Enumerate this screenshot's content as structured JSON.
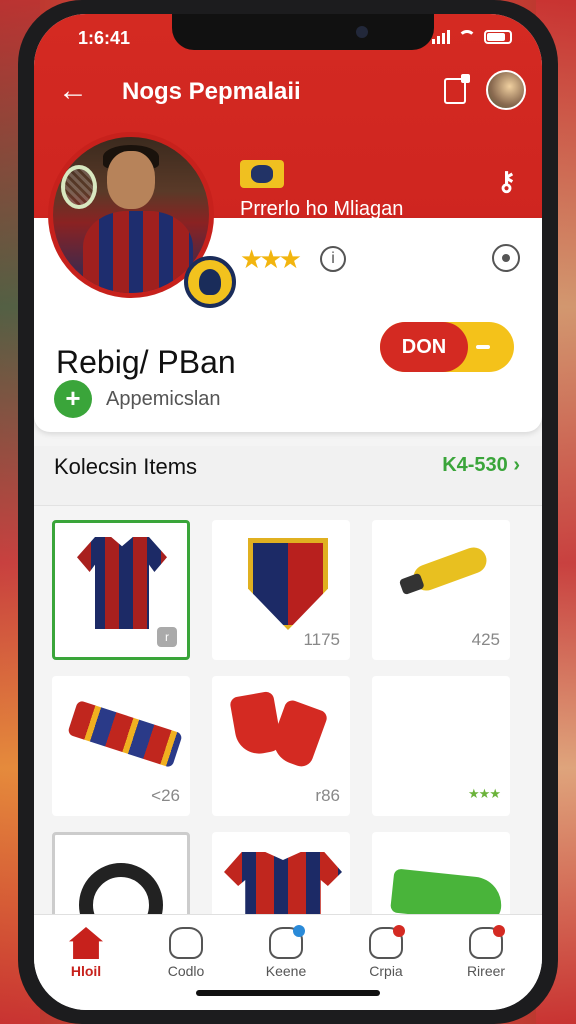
{
  "status": {
    "time": "1:6:41"
  },
  "header": {
    "title": "Nogs Pepmalaii"
  },
  "profile": {
    "club_name": "Prrerlo ho Mliagan",
    "user_name": "Rebig/ PBan",
    "toggle_label": "DON",
    "approve_label": "Appemicslan",
    "stars": "★★★"
  },
  "section": {
    "title": "Kolecsin Items",
    "link": "K4-530 ›"
  },
  "items": [
    {
      "icon": "jersey-icon",
      "selected": true,
      "price": ""
    },
    {
      "icon": "shield-crest-icon",
      "selected": false,
      "price": "1175"
    },
    {
      "icon": "whistle-icon",
      "selected": false,
      "price": "425"
    },
    {
      "icon": "scarf-icon",
      "selected": false,
      "price": "<26"
    },
    {
      "icon": "boots-icon",
      "selected": false,
      "price": "r86"
    },
    {
      "icon": "rating-icon",
      "selected": false,
      "price": "★★★"
    },
    {
      "icon": "bracelet-icon",
      "selected": false,
      "price": ""
    },
    {
      "icon": "jerseys-icon",
      "selected": false,
      "price": ""
    },
    {
      "icon": "green-bag-icon",
      "selected": false,
      "price": ""
    }
  ],
  "tabs": [
    {
      "label": "Hloil",
      "active": true
    },
    {
      "label": "Codlo",
      "active": false
    },
    {
      "label": "Keene",
      "active": false
    },
    {
      "label": "Crpia",
      "active": false
    },
    {
      "label": "Rireer",
      "active": false
    }
  ],
  "colors": {
    "brand_red": "#d42a22",
    "accent_green": "#3aa53a",
    "accent_yellow": "#f4c21a"
  }
}
